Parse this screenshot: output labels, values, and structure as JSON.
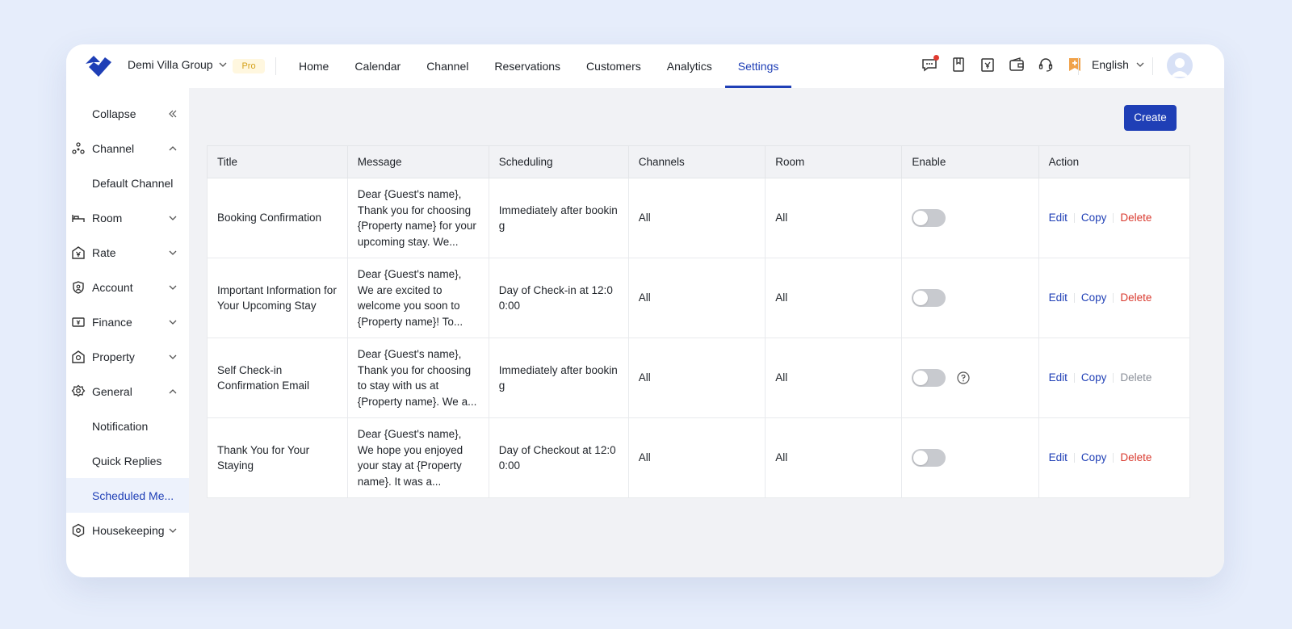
{
  "header": {
    "org_name": "Demi Villa Group",
    "plan_badge": "Pro",
    "nav": [
      {
        "label": "Home"
      },
      {
        "label": "Calendar"
      },
      {
        "label": "Channel"
      },
      {
        "label": "Reservations"
      },
      {
        "label": "Customers"
      },
      {
        "label": "Analytics"
      },
      {
        "label": "Settings",
        "active": true
      }
    ],
    "icons": [
      "message-icon",
      "book-icon",
      "invoice-icon",
      "wallet-icon",
      "headset-icon",
      "bookmark-plus-icon"
    ],
    "language": "English",
    "accent_color": "#1f3fb6"
  },
  "sidebar": {
    "collapse_label": "Collapse",
    "items": [
      {
        "label": "Channel",
        "icon": "channel-icon",
        "expanded": true
      },
      {
        "label": "Default Channel",
        "sub": true
      },
      {
        "label": "Room",
        "icon": "bed-icon",
        "expanded": false
      },
      {
        "label": "Rate",
        "icon": "yen-icon",
        "expanded": false
      },
      {
        "label": "Account",
        "icon": "account-shield-icon",
        "expanded": false
      },
      {
        "label": "Finance",
        "icon": "finance-icon",
        "expanded": false
      },
      {
        "label": "Property",
        "icon": "property-icon",
        "expanded": false
      },
      {
        "label": "General",
        "icon": "gear-icon",
        "expanded": true
      },
      {
        "label": "Notification",
        "sub": true
      },
      {
        "label": "Quick Replies",
        "sub": true
      },
      {
        "label": "Scheduled Me...",
        "sub": true,
        "active": true
      },
      {
        "label": "Housekeeping",
        "icon": "housekeeping-icon",
        "expanded": false
      }
    ]
  },
  "main": {
    "create_label": "Create",
    "columns": [
      "Title",
      "Message",
      "Scheduling",
      "Channels",
      "Room",
      "Enable",
      "Action"
    ],
    "actions": {
      "edit": "Edit",
      "copy": "Copy",
      "delete": "Delete"
    },
    "rows": [
      {
        "title": "Booking Confirmation",
        "message": "Dear {Guest's name}, Thank you for choosing {Property name} for your upcoming stay. We...",
        "scheduling": "Immediately after booking",
        "channels": "All",
        "room": "All",
        "enabled": false,
        "delete_disabled": false
      },
      {
        "title": "Important Information for Your Upcoming Stay",
        "message": "Dear {Guest's name}, We are excited to welcome you soon to {Property name}! To...",
        "scheduling": "Day of Check-in at 12:00:00",
        "channels": "All",
        "room": "All",
        "enabled": false,
        "delete_disabled": false
      },
      {
        "title": "Self Check-in Confirmation Email",
        "message": "Dear {Guest's name}, Thank you for choosing to stay with us at {Property name}. We a...",
        "scheduling": "Immediately after booking",
        "channels": "All",
        "room": "All",
        "enabled": false,
        "delete_disabled": true
      },
      {
        "title": "Thank You for Your Staying",
        "message": "Dear {Guest's name}, We hope you enjoyed your stay at {Property name}. It was a...",
        "scheduling": "Day of Checkout at 12:00:00",
        "channels": "All",
        "room": "All",
        "enabled": false,
        "delete_disabled": false
      }
    ]
  }
}
